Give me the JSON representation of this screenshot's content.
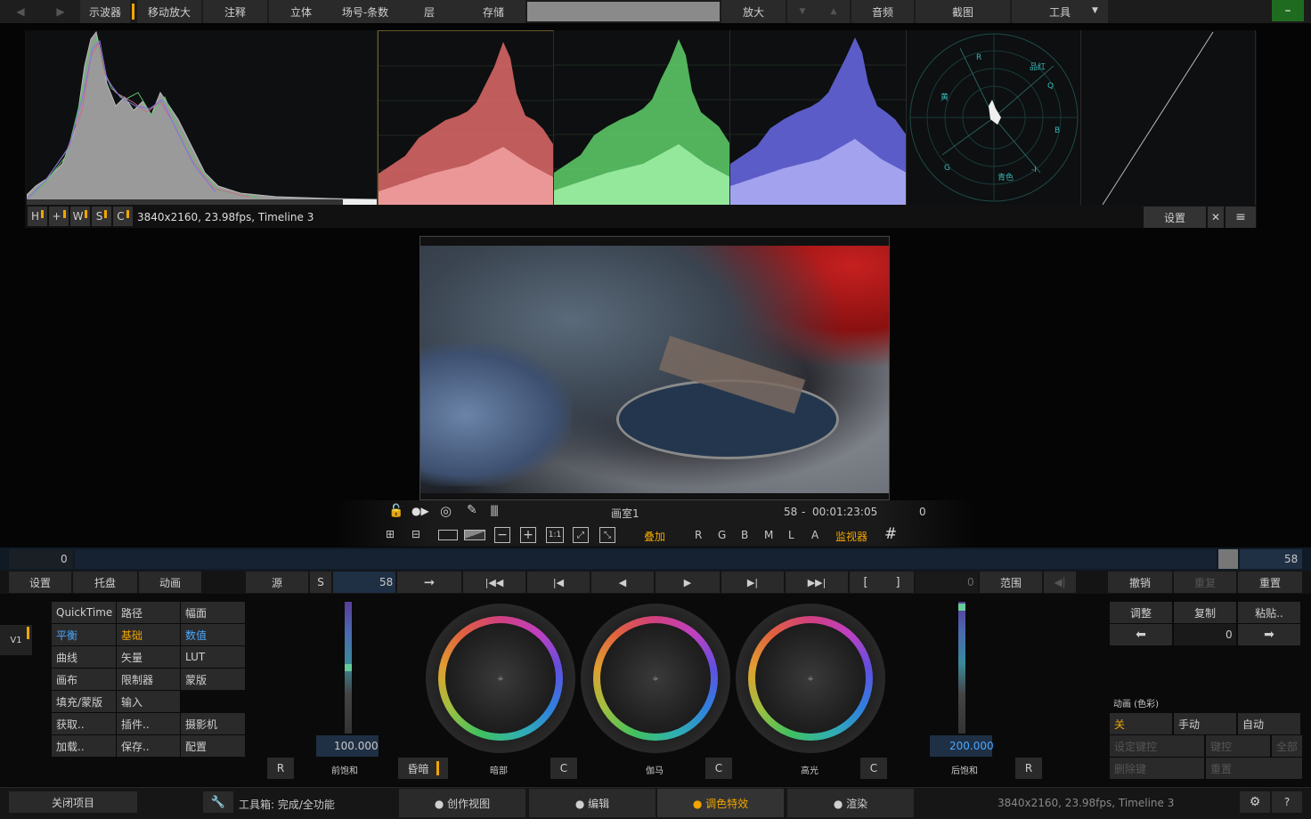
{
  "topbar": {
    "items": [
      "示波器",
      "移动放大",
      "注释",
      "立体",
      "场号-条数",
      "层",
      "存储",
      "放大",
      "音频",
      "截图",
      "工具"
    ],
    "back_arrow": "◀",
    "fwd_arrow": "▶",
    "down_arrow": "▼",
    "up_arrow": "▲",
    "min_btn": "–"
  },
  "scopes": {
    "toggles": [
      "H",
      "+",
      "W",
      "S",
      "C"
    ],
    "info": "3840x2160, 23.98fps, Timeline 3",
    "settings": "设置",
    "close": "✕",
    "menu": "≡",
    "vector_labels": [
      "R",
      "品红",
      "Q",
      "黄",
      "B",
      "G",
      "青色",
      "-I"
    ]
  },
  "viewer": {
    "toolbar": {
      "name": "画室1",
      "frame": "58",
      "sep": "-",
      "timecode": "00:01:23:05",
      "right_value": "0",
      "overlay": "叠加",
      "channels": [
        "R",
        "G",
        "B",
        "M",
        "L",
        "A"
      ],
      "monitor": "监视器",
      "grid": "#",
      "ratio": "1:1"
    }
  },
  "timeline": {
    "start": "0",
    "end": "58"
  },
  "transport": {
    "settings": "设置",
    "tray": "托盘",
    "animation": "动画",
    "source": "源",
    "s": "S",
    "frame": "58",
    "range_val": "0",
    "range": "范围",
    "undo": "撤销",
    "redo": "重复",
    "reset": "重置"
  },
  "track": {
    "label": "V1"
  },
  "menu_grid": {
    "rows": [
      [
        "QuickTime",
        "路径",
        "幅面"
      ],
      [
        "平衡",
        "基础",
        "数值"
      ],
      [
        "曲线",
        "矢量",
        "LUT"
      ],
      [
        "画布",
        "限制器",
        "蒙版"
      ],
      [
        "填充/蒙版",
        "输入",
        ""
      ],
      [
        "获取..",
        "插件..",
        "摄影机"
      ],
      [
        "加载..",
        "保存..",
        "配置"
      ]
    ]
  },
  "color": {
    "left_value": "100.000",
    "right_value": "200.000",
    "r_left": "R",
    "presat": "前饱和",
    "fade": "昏暗",
    "shadows": "暗部",
    "c1": "C",
    "gamma": "伽马",
    "c2": "C",
    "highlights": "高光",
    "c3": "C",
    "postsat": "后饱和",
    "r_right": "R"
  },
  "right_panel": {
    "adjust": "调整",
    "copy": "复制",
    "paste": "粘贴..",
    "value": "0",
    "anim_title": "动画 (色彩)",
    "off": "关",
    "manual": "手动",
    "auto": "自动",
    "set_key": "设定键控",
    "keys": "键控",
    "all": "全部",
    "delete_key": "删除键",
    "reset": "重置"
  },
  "bottombar": {
    "close_project": "关闭项目",
    "toolbox": "工具箱: 完成/全功能",
    "tabs": [
      "● 创作视图",
      "● 编辑",
      "● 调色特效",
      "● 渲染"
    ],
    "info": "3840x2160, 23.98fps, Timeline 3",
    "help": "?"
  },
  "colors": {
    "accent": "#f0a500",
    "blue": "#4aa8ff",
    "green_btn": "#1f6b1f"
  }
}
